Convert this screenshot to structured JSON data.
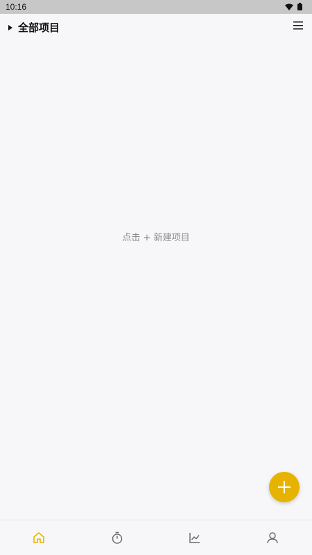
{
  "status_bar": {
    "time": "10:16",
    "icons": [
      "wifi-icon",
      "battery-icon"
    ]
  },
  "header": {
    "title": "全部项目",
    "dropdown_icon": "caret-right-icon",
    "menu_icon": "hamburger-menu-icon"
  },
  "main": {
    "empty_hint": "点击 + 新建项目"
  },
  "fab": {
    "icon": "plus-icon",
    "color": "#e6b400"
  },
  "bottom_nav": {
    "active_color": "#e6b400",
    "inactive_color": "#6d6d6d",
    "items": [
      {
        "icon": "home-icon",
        "active": true
      },
      {
        "icon": "timer-icon",
        "active": false
      },
      {
        "icon": "chart-icon",
        "active": false
      },
      {
        "icon": "profile-icon",
        "active": false
      }
    ]
  }
}
